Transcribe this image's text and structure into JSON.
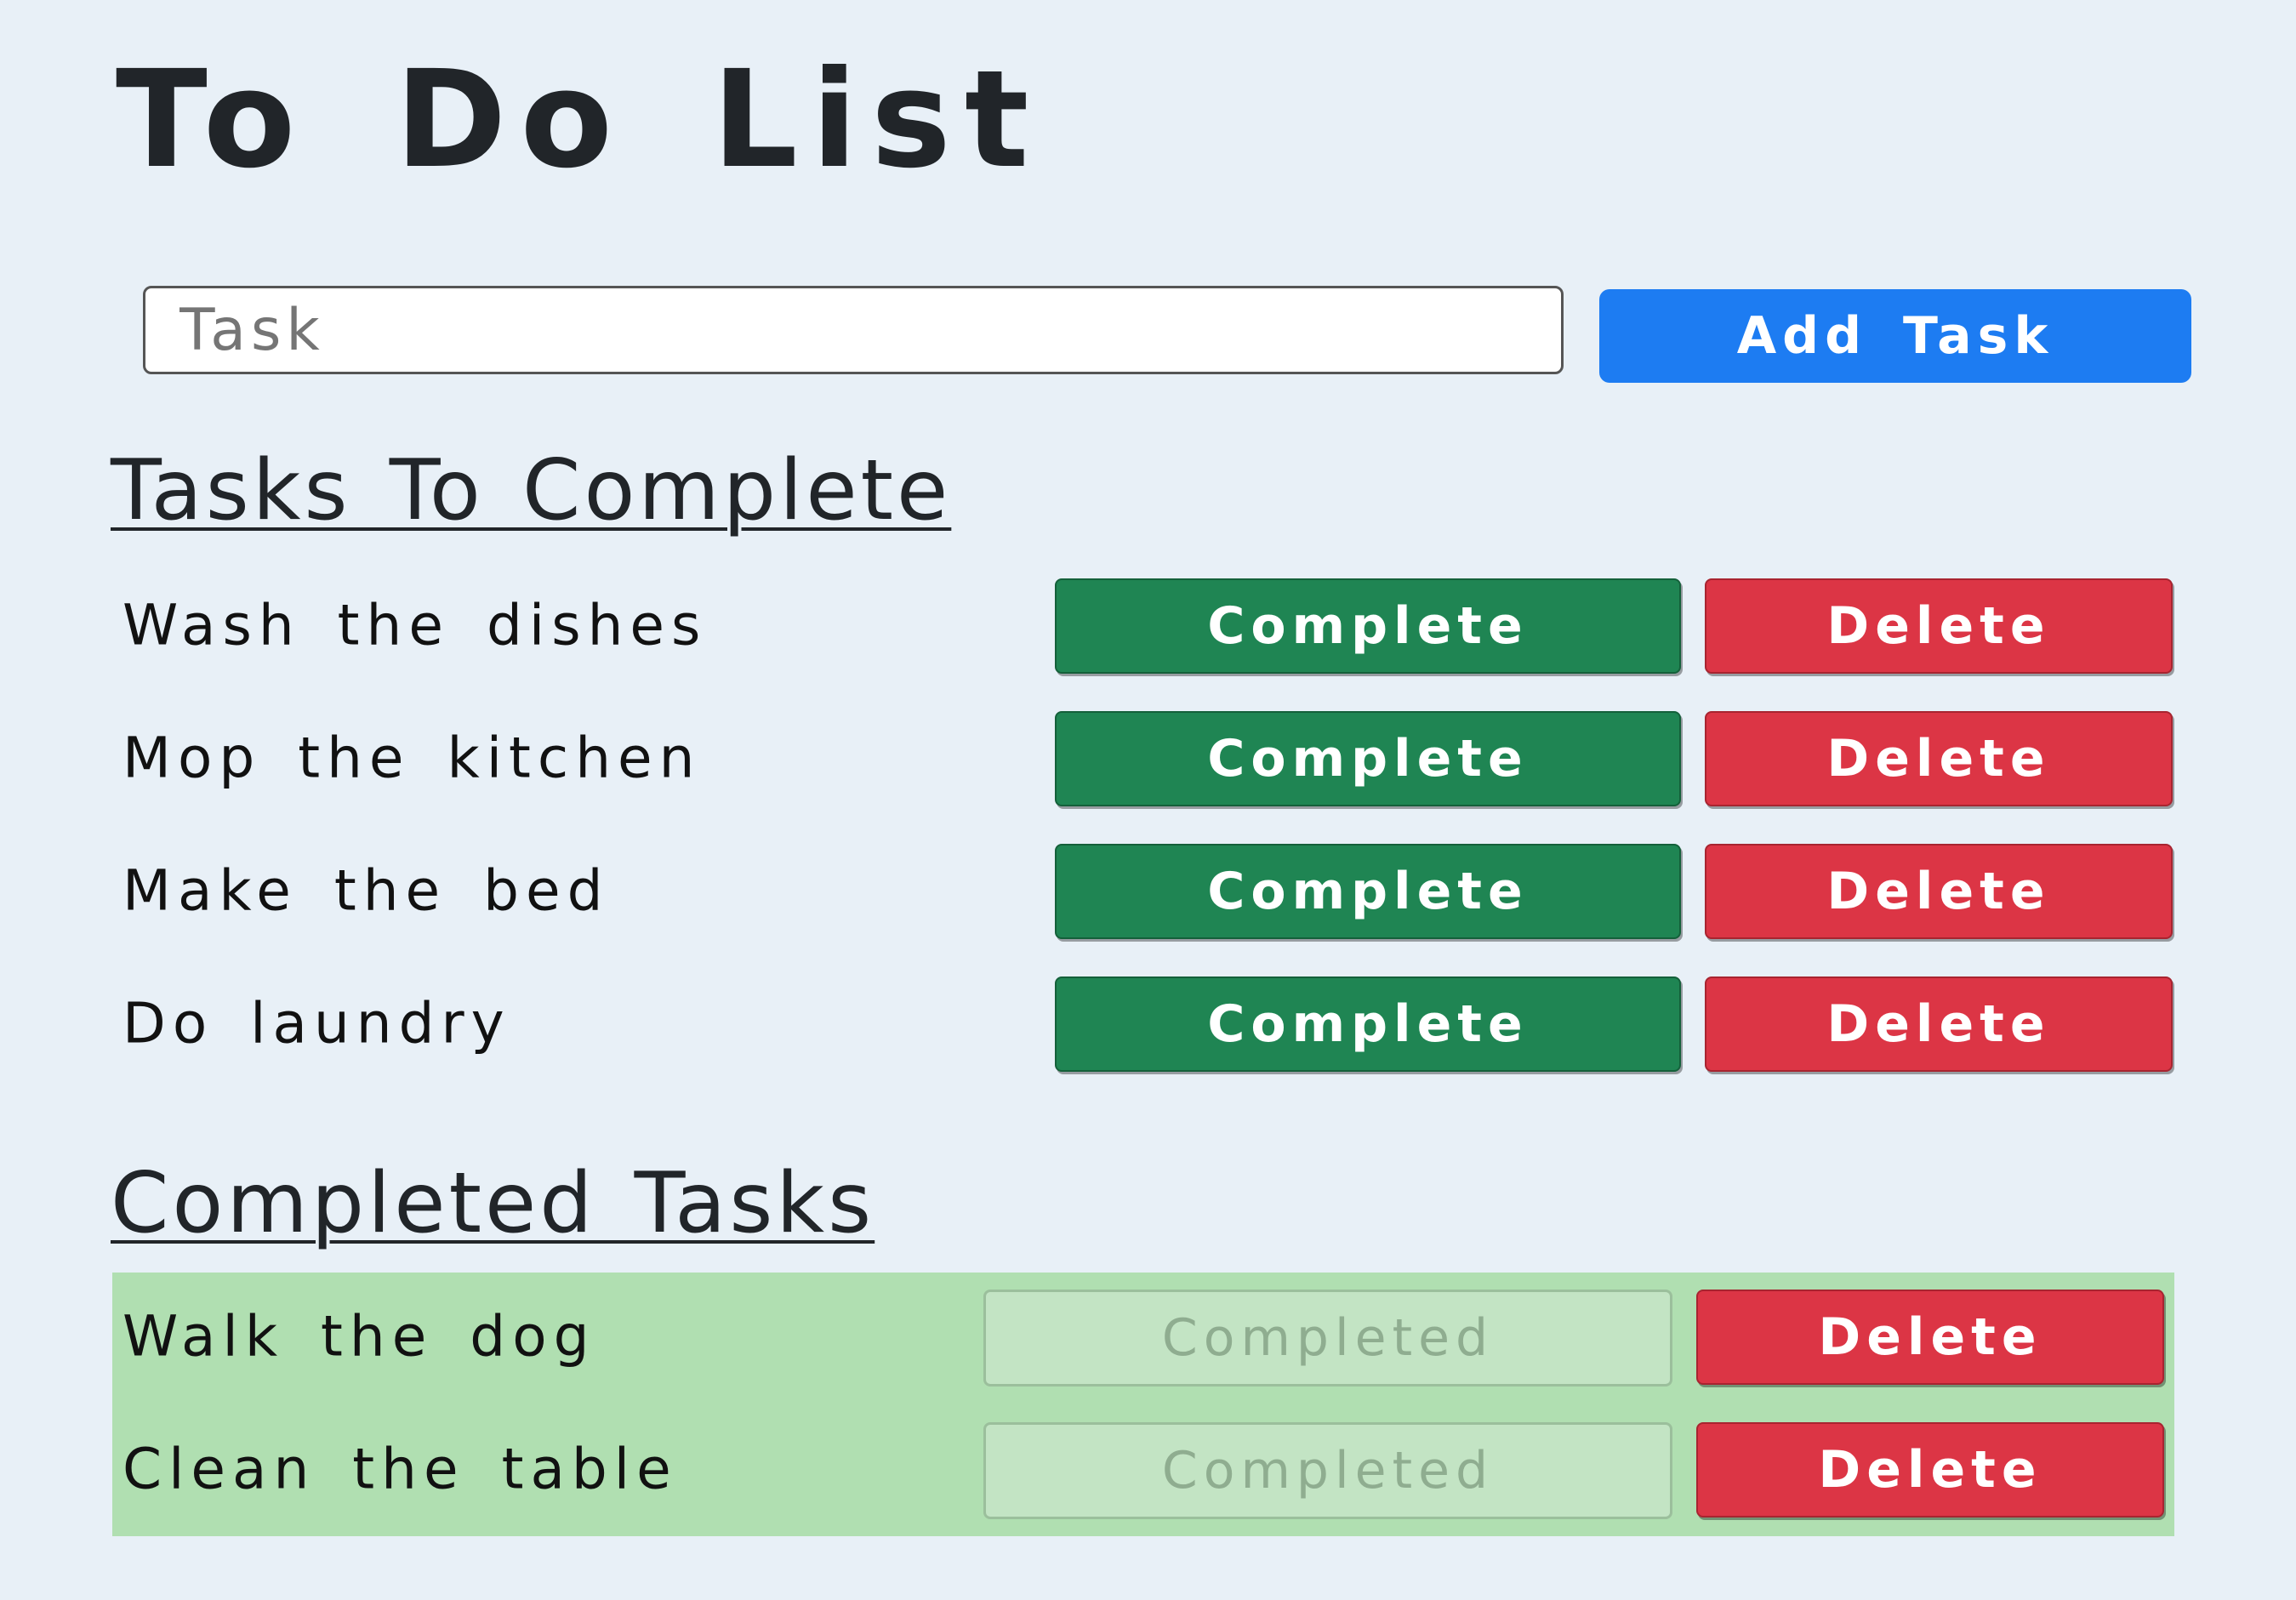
{
  "app": {
    "title": "To Do List"
  },
  "input": {
    "placeholder": "Task",
    "value": ""
  },
  "add_button": {
    "label": "Add Task"
  },
  "sections": {
    "todo_heading": "Tasks To Complete",
    "done_heading": "Completed Tasks"
  },
  "todo": [
    {
      "task": "Wash the dishes",
      "complete_label": "Complete",
      "delete_label": "Delete"
    },
    {
      "task": "Mop the kitchen",
      "complete_label": "Complete",
      "delete_label": "Delete"
    },
    {
      "task": "Make the bed",
      "complete_label": "Complete",
      "delete_label": "Delete"
    },
    {
      "task": "Do laundry",
      "complete_label": "Complete",
      "delete_label": "Delete"
    }
  ],
  "done": [
    {
      "task": "Walk the dog",
      "completed_label": "Completed",
      "delete_label": "Delete"
    },
    {
      "task": "Clean the table",
      "completed_label": "Completed",
      "delete_label": "Delete"
    }
  ],
  "colors": {
    "background": "#e8f0f7",
    "primary": "#1d7cf2",
    "success": "#1f8553",
    "danger": "#dc3545",
    "completed_bg": "#b0dfb1"
  }
}
